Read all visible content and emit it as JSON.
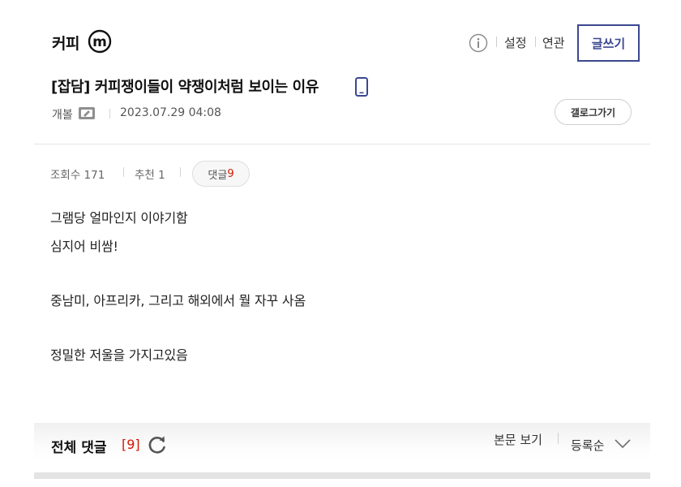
{
  "header": {
    "gallery_name": "커피",
    "badge_letter": "m",
    "links": [
      "설정",
      "연관"
    ],
    "write_label": "글쓰기"
  },
  "post": {
    "title": "[잡담] 커피쟁이들이 약쟁이처럼 보이는 이유",
    "author": "개볼",
    "date": "2023.07.29 04:08",
    "gallery_button": "갤로그가기"
  },
  "stats": {
    "views_label": "조회수 171",
    "recommend_label": "추천 1",
    "comment_label": "댓글",
    "comment_count": "9"
  },
  "body": {
    "lines": [
      "그램당 얼마인지 이야기함",
      "심지어 비쌈!",
      "중남미, 아프리카, 그리고 해외에서 뭘 자꾸 사옴",
      "정밀한 저울을 가지고있음"
    ]
  },
  "comments_bar": {
    "title": "전체 댓글",
    "count": "[9]",
    "view_body": "본문 보기",
    "sort": "등록순"
  },
  "colors": {
    "accent": "#3b4890",
    "count_red": "#d31900"
  }
}
